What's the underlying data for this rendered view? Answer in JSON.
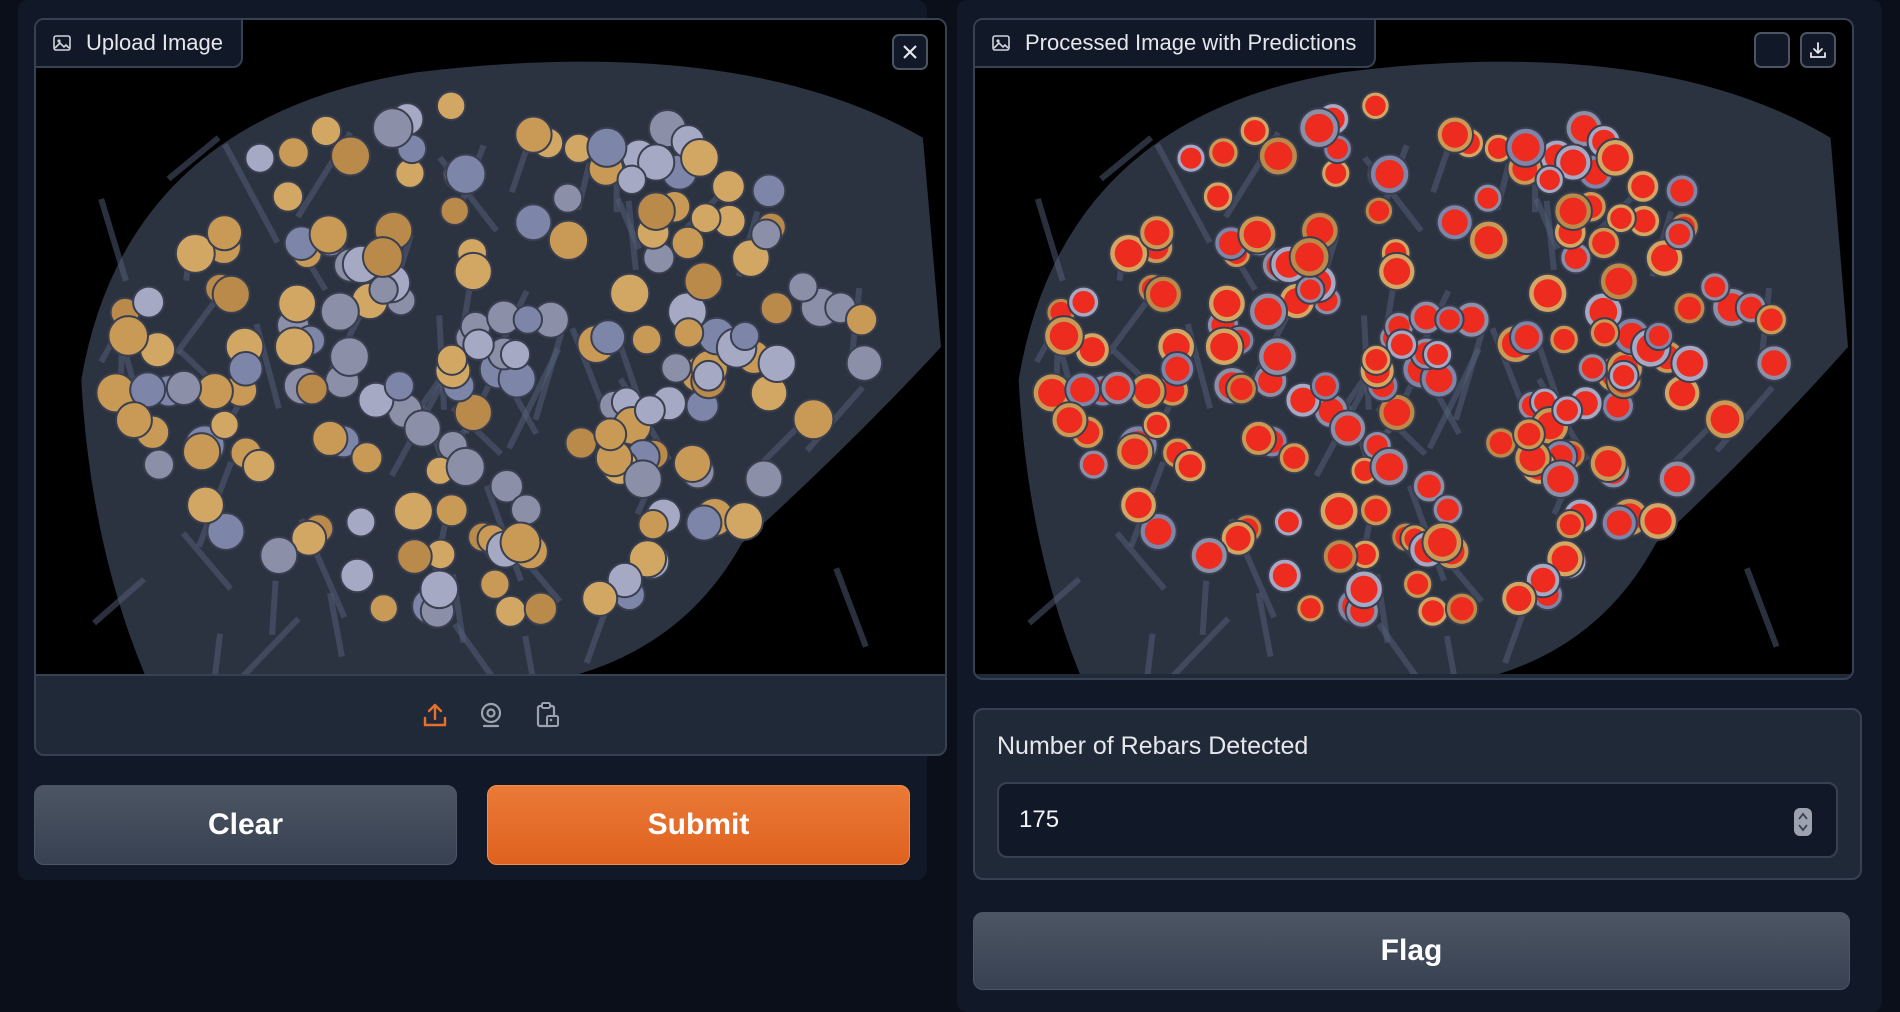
{
  "left_panel": {
    "upload_label": "Upload Image",
    "close_icon": "close-icon",
    "source_icons": [
      "upload-icon",
      "webcam-icon",
      "clipboard-icon"
    ]
  },
  "buttons": {
    "clear_label": "Clear",
    "submit_label": "Submit",
    "flag_label": "Flag"
  },
  "right_panel": {
    "output_label": "Processed Image with Predictions",
    "download_icon": "download-icon",
    "share_icon": "share-icon"
  },
  "count_field": {
    "label": "Number of Rebars Detected",
    "value": "175"
  },
  "colors": {
    "accent": "#e8702f",
    "prediction_dot": "#ee2b1f",
    "background": "#0b0f19",
    "panel": "#1f2937"
  }
}
